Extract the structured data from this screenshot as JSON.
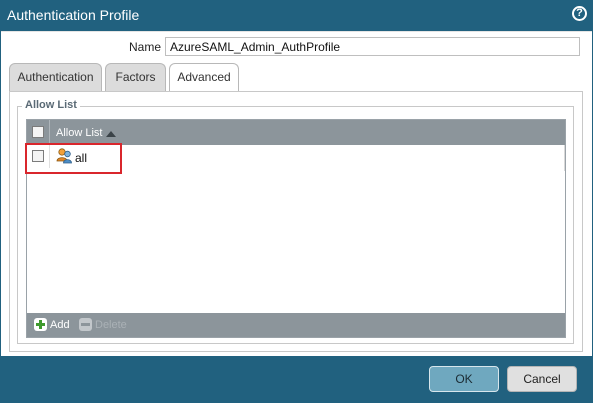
{
  "dialog": {
    "title": "Authentication Profile",
    "help_icon": "help-icon",
    "help_glyph": "?"
  },
  "form": {
    "name_label": "Name",
    "name_value": "AzureSAML_Admin_AuthProfile"
  },
  "tabs": [
    {
      "label": "Authentication",
      "active": false
    },
    {
      "label": "Factors",
      "active": false
    },
    {
      "label": "Advanced",
      "active": true
    }
  ],
  "allow_list": {
    "section_title": "Allow List",
    "column_header": "Allow List",
    "sort": "ascending",
    "rows": [
      {
        "value": "all",
        "icon": "user-group-icon",
        "checked": false
      }
    ],
    "toolbar": {
      "add_label": "Add",
      "delete_label": "Delete",
      "delete_enabled": false
    }
  },
  "buttons": {
    "ok_label": "OK",
    "cancel_label": "Cancel"
  },
  "colors": {
    "titlebar": "#21617f",
    "grid_header": "#8c959b",
    "highlight": "#d9262c",
    "add_icon": "#3f9a2e"
  }
}
